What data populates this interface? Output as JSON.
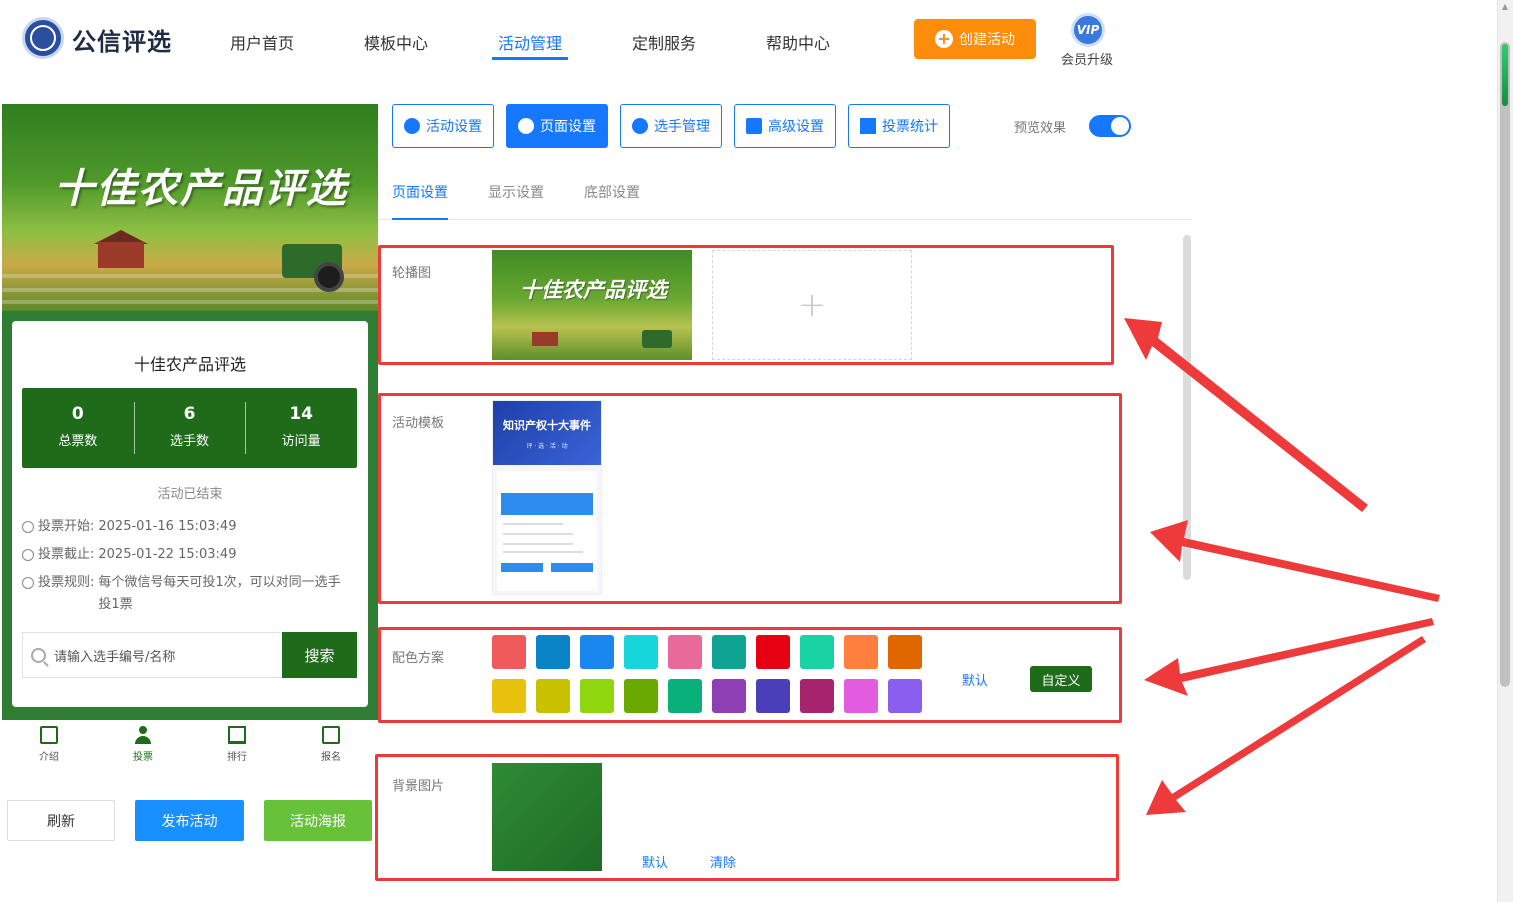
{
  "header": {
    "brand": "公信评选",
    "nav": [
      "用户首页",
      "模板中心",
      "活动管理",
      "定制服务",
      "帮助中心"
    ],
    "active_nav": "活动管理",
    "create_label": "创建活动",
    "vip_badge": "VIP",
    "vip_label": "会员升级"
  },
  "preview": {
    "banner_title": "十佳农产品评选",
    "card_title": "十佳农产品评选",
    "stats": [
      {
        "value": "0",
        "label": "总票数"
      },
      {
        "value": "6",
        "label": "选手数"
      },
      {
        "value": "14",
        "label": "访问量"
      }
    ],
    "status": "活动已结束",
    "vote_start_label": "投票开始:",
    "vote_start": "2025-01-16 15:03:49",
    "vote_end_label": "投票截止:",
    "vote_end": "2025-01-22 15:03:49",
    "rule_label": "投票规则:",
    "rule_text": "每个微信号每天可投1次，可以对同一选手投1票",
    "search_placeholder": "请输入选手编号/名称",
    "search_button": "搜索",
    "tabs": [
      "介绍",
      "投票",
      "排行",
      "报名"
    ],
    "active_tab": "投票"
  },
  "actions": {
    "refresh": "刷新",
    "publish": "发布活动",
    "poster": "活动海报"
  },
  "settings": {
    "top_buttons": [
      "活动设置",
      "页面设置",
      "选手管理",
      "高级设置",
      "投票统计"
    ],
    "active_top_button": "页面设置",
    "preview_label": "预览效果",
    "preview_on": true,
    "sub_tabs": [
      "页面设置",
      "显示设置",
      "底部设置"
    ],
    "active_sub_tab": "页面设置",
    "carousel_label": "轮播图",
    "carousel_thumb_title": "十佳农产品评选",
    "template_label": "活动模板",
    "template_thumb_title": "知识产权十大事件",
    "template_thumb_sub": "评 · 选 · 活 · 动",
    "color_label": "配色方案",
    "color_default": "默认",
    "color_custom": "自定义",
    "swatches": [
      "#f05a5a",
      "#0a84c6",
      "#1a87ee",
      "#16d6dc",
      "#e8699a",
      "#0ea393",
      "#e60012",
      "#19d3a4",
      "#ff7f3f",
      "#e06600",
      "#e8c20f",
      "#c8c100",
      "#90d60e",
      "#6aaa00",
      "#0ab07a",
      "#8e3fb3",
      "#4b3fb7",
      "#a8236e",
      "#e35ce0",
      "#8c5ef0"
    ],
    "bg_label": "背景图片",
    "bg_default": "默认",
    "bg_clear": "清除"
  }
}
